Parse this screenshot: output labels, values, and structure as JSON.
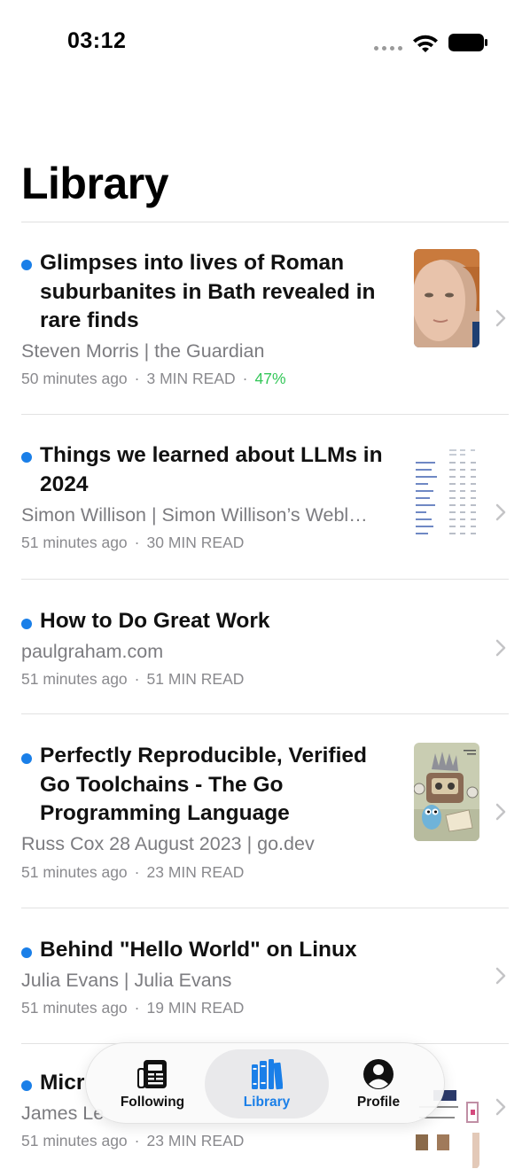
{
  "status_bar": {
    "time": "03:12"
  },
  "page": {
    "title": "Library"
  },
  "articles": [
    {
      "title": "Glimpses into lives of Roman suburbanites in Bath revealed in rare finds",
      "byline": "Steven Morris | the Guardian",
      "time_ago": "50 minutes ago",
      "read_time": "3 MIN READ",
      "progress": "47%",
      "unread": true,
      "thumbnail": "person-portrait"
    },
    {
      "title": "Things we learned about LLMs in 2024",
      "byline": "Simon Willison | Simon Willison’s Webl…",
      "time_ago": "51 minutes ago",
      "read_time": "30 MIN READ",
      "unread": true,
      "thumbnail": "data-table"
    },
    {
      "title": "How to Do Great Work",
      "byline": "paulgraham.com",
      "time_ago": "51 minutes ago",
      "read_time": "51 MIN READ",
      "unread": true
    },
    {
      "title": "Perfectly Reproducible, Verified Go Toolchains - The Go Programming Language",
      "byline": "Russ Cox 28 August 2023 | go.dev",
      "time_ago": "51 minutes ago",
      "read_time": "23 MIN READ",
      "unread": true,
      "thumbnail": "go-gopher-illustration"
    },
    {
      "title": "Behind \"Hello World\" on Linux",
      "byline": "Julia Evans | Julia Evans",
      "time_ago": "51 minutes ago",
      "read_time": "19 MIN READ",
      "unread": true
    },
    {
      "title": "Micr",
      "byline": "James Le",
      "time_ago": "51 minutes ago",
      "read_time": "23 MIN READ",
      "unread": true,
      "thumbnail": "article-preview"
    }
  ],
  "tab_bar": {
    "tabs": [
      {
        "label": "Following",
        "icon": "newspaper-icon",
        "active": false
      },
      {
        "label": "Library",
        "icon": "books-icon",
        "active": true
      },
      {
        "label": "Profile",
        "icon": "person-circle-icon",
        "active": false
      }
    ]
  },
  "colors": {
    "accent": "#1a7fe8",
    "progress": "#34c759",
    "secondary_text": "#7c7c80"
  }
}
